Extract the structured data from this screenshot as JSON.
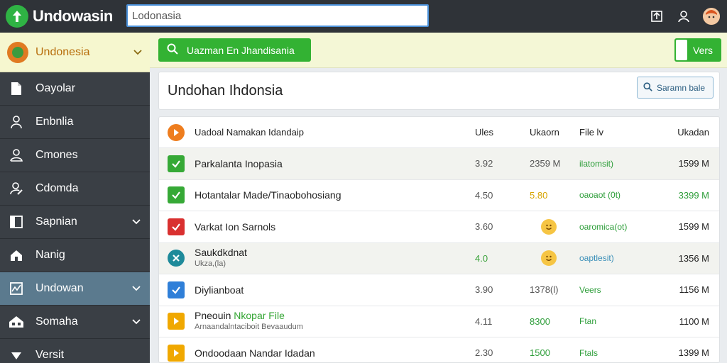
{
  "app": {
    "name": "Undowasin",
    "search_value": "Lodonasia"
  },
  "sidebar": {
    "country": "Undonesia",
    "items": [
      {
        "label": "Oayolar",
        "icon": "document-icon",
        "expandable": false
      },
      {
        "label": "Enbnlia",
        "icon": "user-icon",
        "expandable": false
      },
      {
        "label": "Cmones",
        "icon": "user-outline-icon",
        "expandable": false
      },
      {
        "label": "Cdomda",
        "icon": "user-edit-icon",
        "expandable": false
      },
      {
        "label": "Sapnian",
        "icon": "panel-icon",
        "expandable": true
      },
      {
        "label": "Nanig",
        "icon": "home-icon",
        "expandable": false
      },
      {
        "label": "Undowan",
        "icon": "chart-box-icon",
        "expandable": true,
        "active": true
      },
      {
        "label": "Somaha",
        "icon": "house-group-icon",
        "expandable": true
      },
      {
        "label": "Versit",
        "icon": "arrow-down-icon",
        "expandable": false
      }
    ]
  },
  "toolbar": {
    "primary_button": "Uazman En Jhandisania",
    "toggle_label": "Vers"
  },
  "main": {
    "title": "Undohan Ihdonsia",
    "search_button": "Saramn bale"
  },
  "table": {
    "headers": {
      "name": "Uadoal Namakan Idandaip",
      "col1": "Ules",
      "col2": "Ukaorn",
      "col3": "File lv",
      "col4": "Ukadan"
    },
    "rows": [
      {
        "name": "Parkalanta Inopasia",
        "sub": "",
        "col1": "3.92",
        "col2": "2359 M",
        "col3": "ilatomsit)",
        "col4": "1599 M",
        "icon": "check-green"
      },
      {
        "name": "Hotantalar Made/Tinaobohosiang",
        "sub": "",
        "col1": "4.50",
        "col2": "5.80",
        "col3": "oaoaot (0t)",
        "col4": "3399 M",
        "icon": "check-green"
      },
      {
        "name": "Varkat Ion Sarnols",
        "sub": "",
        "col1": "3.60",
        "col2": "",
        "col3": "oaromica(ot)",
        "col4": "1599 M",
        "icon": "check-red"
      },
      {
        "name": "Saukdkdnat",
        "sub": "Ukza,(la)",
        "col1": "4.0",
        "col2": "",
        "col3": "oaptlesit)",
        "col4": "1356 M",
        "icon": "cross-teal"
      },
      {
        "name": "Diylianboat",
        "sub": "",
        "col1": "3.90",
        "col2": "1378(l)",
        "col3": "Veers",
        "col4": "1156 M",
        "icon": "check-blue"
      },
      {
        "name": "Pneouin",
        "name_hl": "Nkopar File",
        "sub": "Arnaandalntaciboit Bevaaudum",
        "col1": "4.11",
        "col2": "8300",
        "col3": "Ftan",
        "col4": "1100 M",
        "icon": "play-yellow"
      },
      {
        "name": "Ondoodaan Nandar Idadan",
        "sub": "",
        "col1": "2.30",
        "col2": "1500",
        "col3": "Ftals",
        "col4": "1399 M",
        "icon": "play-yellow"
      }
    ]
  }
}
